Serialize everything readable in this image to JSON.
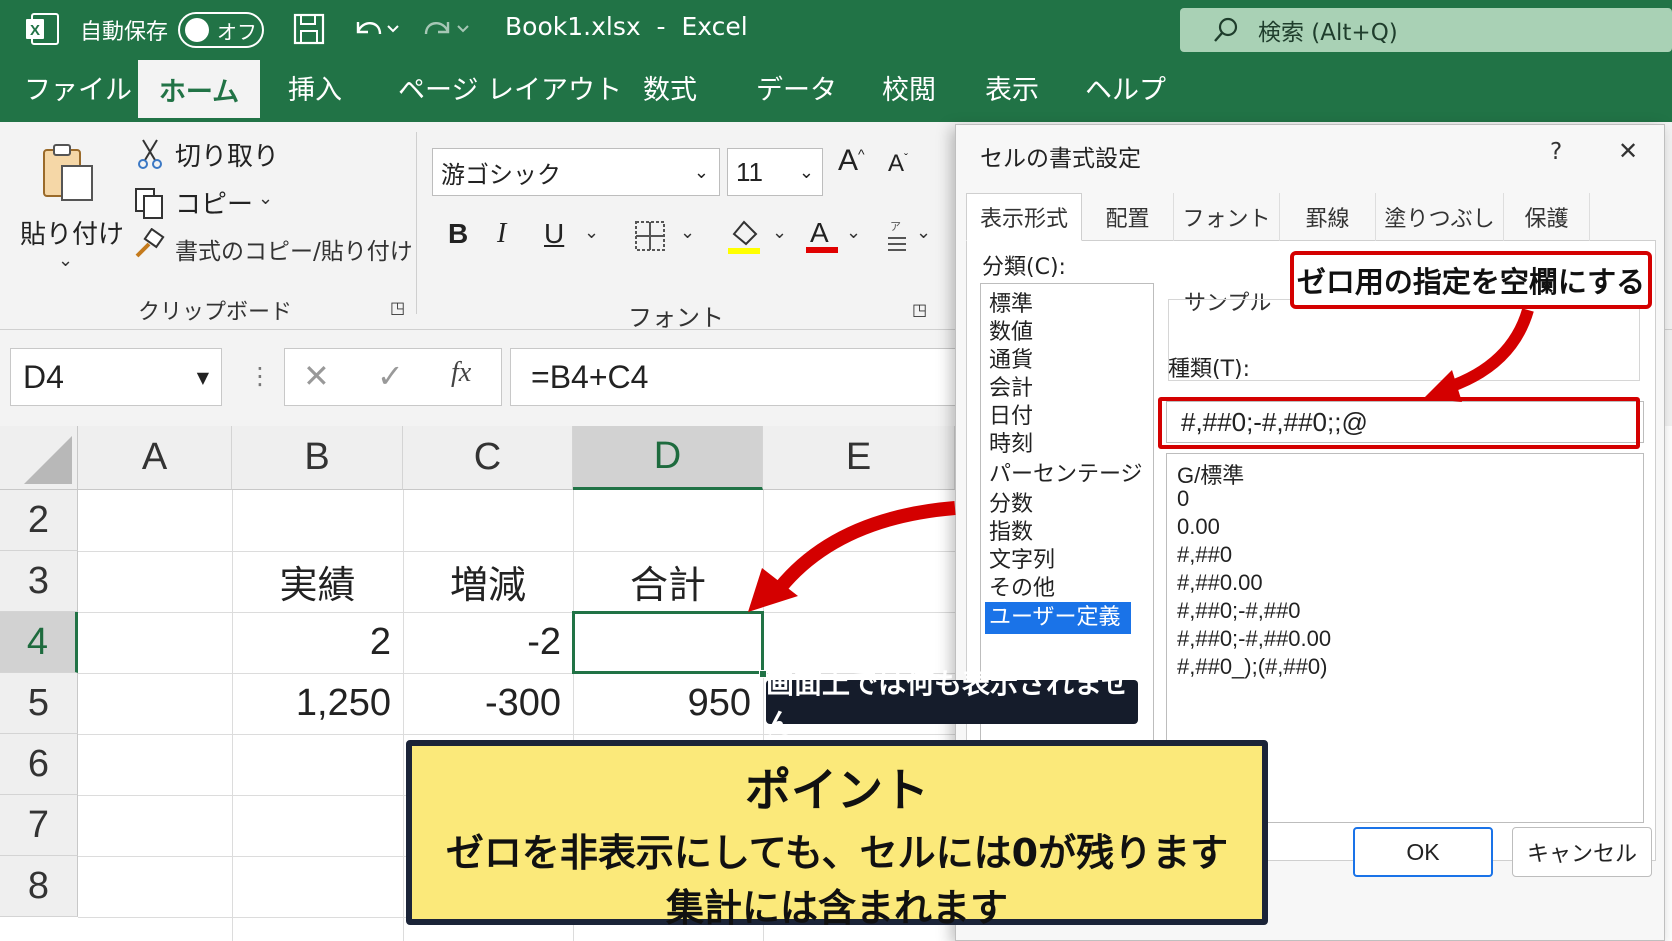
{
  "titlebar": {
    "autosave_label": "自動保存",
    "toggle_state": "オフ",
    "title": "Book1.xlsx  -  Excel",
    "search_placeholder": "検索 (Alt+Q)"
  },
  "tabs": [
    "ファイル",
    "ホーム",
    "挿入",
    "ページ レイアウト",
    "数式",
    "データ",
    "校閲",
    "表示",
    "ヘルプ"
  ],
  "clipboard": {
    "paste": "貼り付け",
    "cut": "切り取り",
    "copy": "コピー",
    "format_painter": "書式のコピー/貼り付け",
    "group_label": "クリップボード"
  },
  "font": {
    "font_name": "游ゴシック",
    "font_size": "11",
    "group_label": "フォント",
    "bold": "B",
    "italic": "I",
    "underline": "U",
    "grow": "A",
    "shrink": "A"
  },
  "formula_bar": {
    "name_box": "D4",
    "fx": "fx",
    "formula": "=B4+C4"
  },
  "sheet": {
    "columns": [
      "A",
      "B",
      "C",
      "D",
      "E"
    ],
    "rows": [
      "2",
      "3",
      "4",
      "5",
      "6",
      "7",
      "8"
    ],
    "headers": {
      "b3": "実績",
      "c3": "増減",
      "d3": "合計"
    },
    "values": {
      "b4": "2",
      "c4": "-2",
      "d4": "",
      "b5": "1,250",
      "c5": "-300",
      "d5": "950"
    }
  },
  "dialog": {
    "title": "セルの書式設定",
    "help": "?",
    "close": "✕",
    "tabs": [
      "表示形式",
      "配置",
      "フォント",
      "罫線",
      "塗りつぶし",
      "保護"
    ],
    "category_label": "分類(C):",
    "categories": [
      "標準",
      "数値",
      "通貨",
      "会計",
      "日付",
      "時刻",
      "パーセンテージ",
      "分数",
      "指数",
      "文字列",
      "その他",
      "ユーザー定義"
    ],
    "selected_category": "ユーザー定義",
    "sample_label": "サンプル",
    "type_label": "種類(T):",
    "type_value": "#,##0;-#,##0;;@",
    "type_list": [
      "G/標準",
      "0",
      "0.00",
      "#,##0",
      "#,##0.00",
      "#,##0;-#,##0",
      "#,##0;-#,##0.00",
      "#,##0_);(#,##0)"
    ],
    "ok": "OK",
    "cancel": "キャンセル"
  },
  "annotations": {
    "zero_callout": "ゼロ用の指定を空欄にする",
    "display_note": "画面上では何も表示されません",
    "point_title": "ポイント",
    "point_line1": "ゼロを非表示にしても、セルには0が残ります",
    "point_line2": "集計には含まれます"
  },
  "colors": {
    "excel_green": "#217346",
    "callout_red": "#d40000",
    "selection_blue": "#1a73e8",
    "point_yellow": "#fbe97a"
  }
}
